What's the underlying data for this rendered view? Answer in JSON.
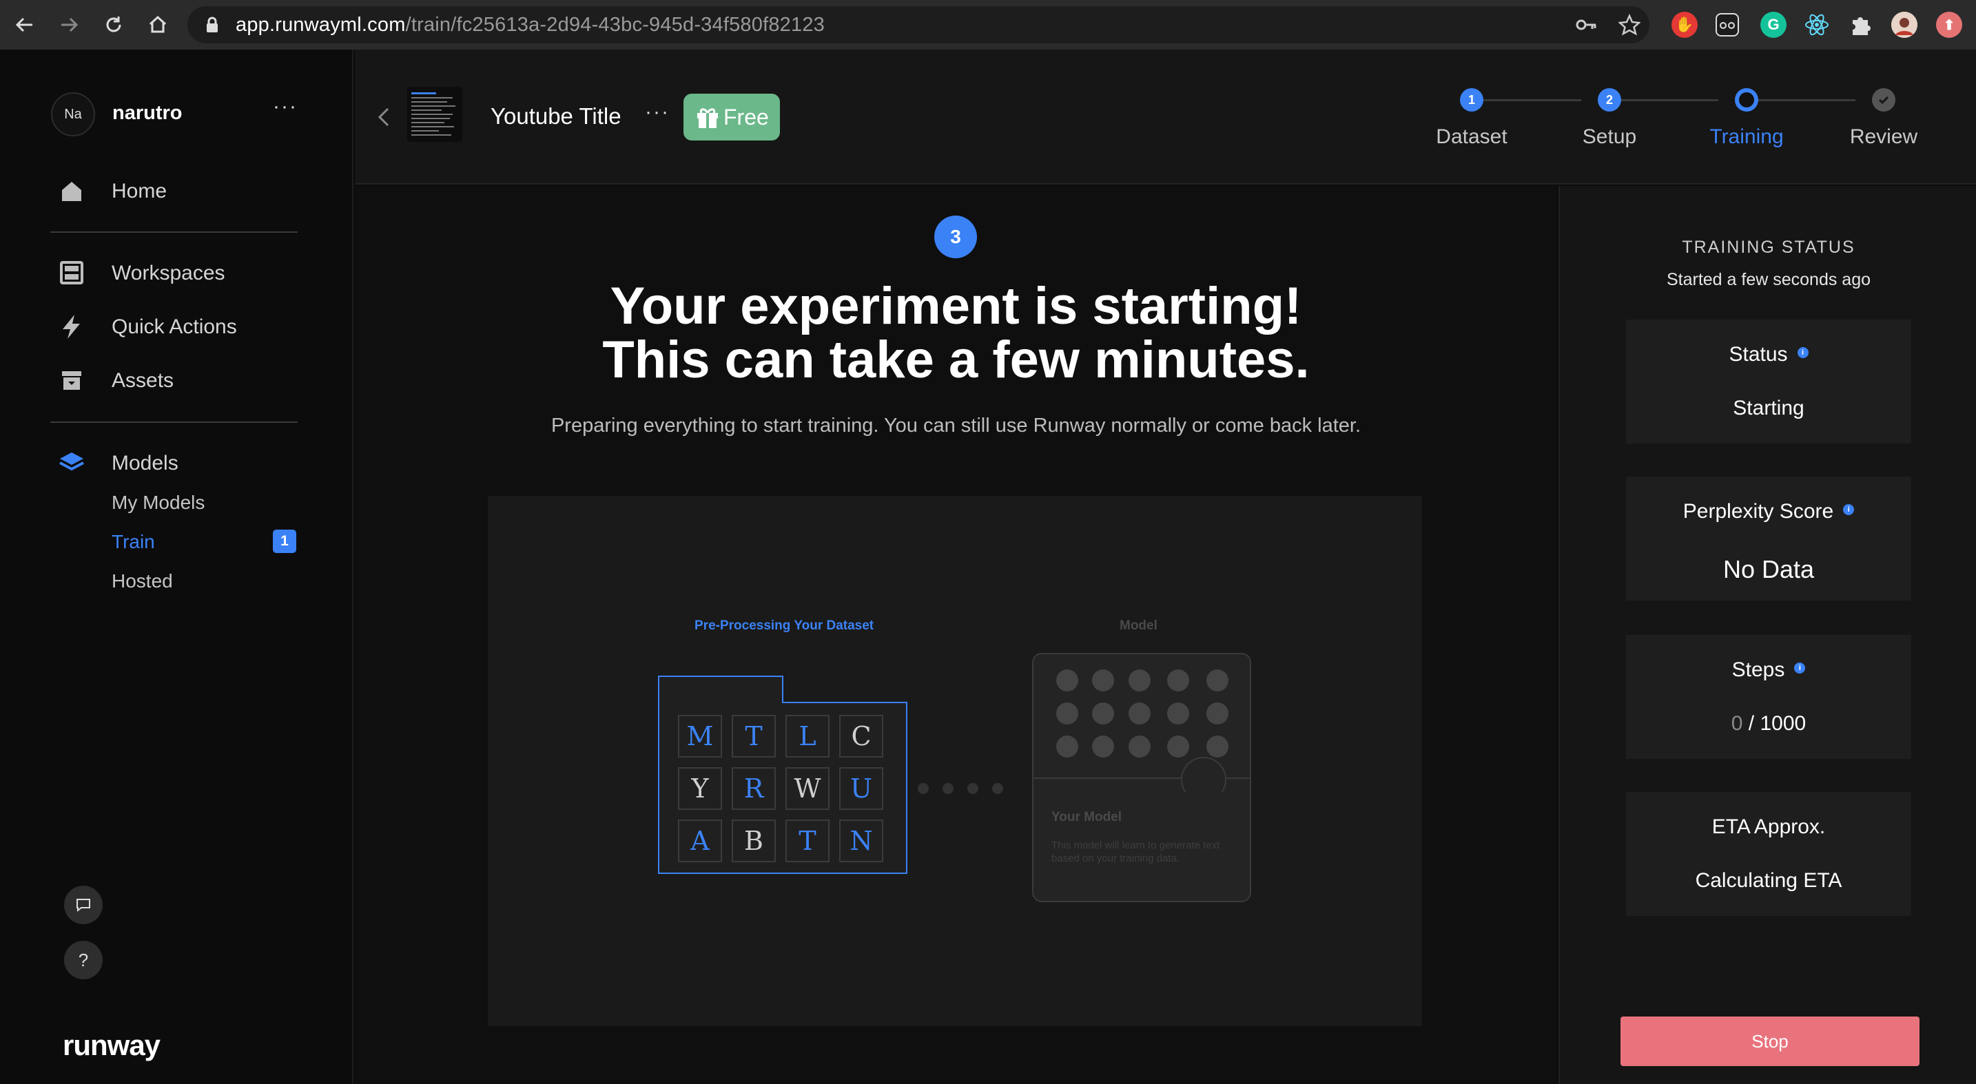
{
  "browser": {
    "url_host": "app.runwayml.com",
    "url_path": "/train/fc25613a-2d94-43bc-945d-34f580f82123"
  },
  "sidebar": {
    "avatar_initials": "Na",
    "username": "narutro",
    "more": "···",
    "home": "Home",
    "workspaces": "Workspaces",
    "quick_actions": "Quick Actions",
    "assets": "Assets",
    "models": "Models",
    "my_models": "My Models",
    "train": "Train",
    "train_badge": "1",
    "hosted": "Hosted",
    "help": "?",
    "logo": "runway"
  },
  "header": {
    "title": "Youtube Title",
    "more": "···",
    "free_tag": "Free",
    "steps": [
      {
        "number": "1",
        "label": "Dataset",
        "state": "done"
      },
      {
        "number": "2",
        "label": "Setup",
        "state": "done"
      },
      {
        "number": "",
        "label": "Training",
        "state": "active"
      },
      {
        "number": "",
        "label": "Review",
        "state": "pending"
      }
    ]
  },
  "main": {
    "step_number": "3",
    "headline_line1": "Your experiment is starting!",
    "headline_line2": "This can take a few minutes.",
    "subtext": "Preparing everything to start training. You can still use Runway normally or come back later.",
    "illustration": {
      "preprocessing_label": "Pre-Processing Your Dataset",
      "model_label": "Model",
      "letters": [
        {
          "ch": "M",
          "tone": "blue"
        },
        {
          "ch": "T",
          "tone": "blue"
        },
        {
          "ch": "L",
          "tone": "blue"
        },
        {
          "ch": "C",
          "tone": "gray"
        },
        {
          "ch": "Y",
          "tone": "gray"
        },
        {
          "ch": "R",
          "tone": "blue"
        },
        {
          "ch": "W",
          "tone": "gray"
        },
        {
          "ch": "U",
          "tone": "blue"
        },
        {
          "ch": "A",
          "tone": "blue"
        },
        {
          "ch": "B",
          "tone": "gray"
        },
        {
          "ch": "T",
          "tone": "blue"
        },
        {
          "ch": "N",
          "tone": "blue"
        }
      ],
      "model_card_title": "Your Model",
      "model_card_desc": "This model will learn to generate text based on your training data."
    }
  },
  "panel": {
    "title": "TRAINING STATUS",
    "subtitle": "Started a few seconds ago",
    "status_label": "Status",
    "status_value": "Starting",
    "perplexity_label": "Perplexity Score",
    "perplexity_value": "No Data",
    "steps_label": "Steps",
    "steps_current": "0",
    "steps_total": "1000",
    "eta_label": "ETA Approx.",
    "eta_value": "Calculating ETA",
    "stop_button": "Stop"
  },
  "colors": {
    "accent": "#3b82f6",
    "free_tag": "#6bb88a",
    "stop": "#e8737d"
  }
}
